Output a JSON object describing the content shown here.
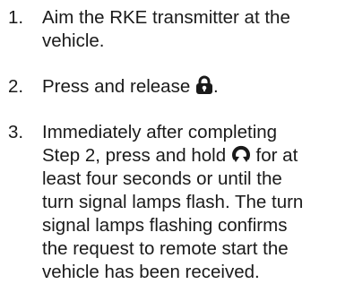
{
  "steps": [
    {
      "number": "1.",
      "lines": [
        "Aim the RKE transmitter at the",
        "vehicle."
      ]
    },
    {
      "number": "2.",
      "text_before": "Press and release",
      "icon": "lock-icon",
      "text_after": "."
    },
    {
      "number": "3.",
      "line1": "Immediately after completing",
      "line2_before": "Step 2, press and hold",
      "icon": "remote-start-icon",
      "line2_after": "for at",
      "lines_rest": [
        "least four seconds or until the",
        "turn signal lamps flash. The turn",
        "signal lamps flashing confirms",
        "the request to remote start the",
        "vehicle has been received."
      ]
    }
  ]
}
